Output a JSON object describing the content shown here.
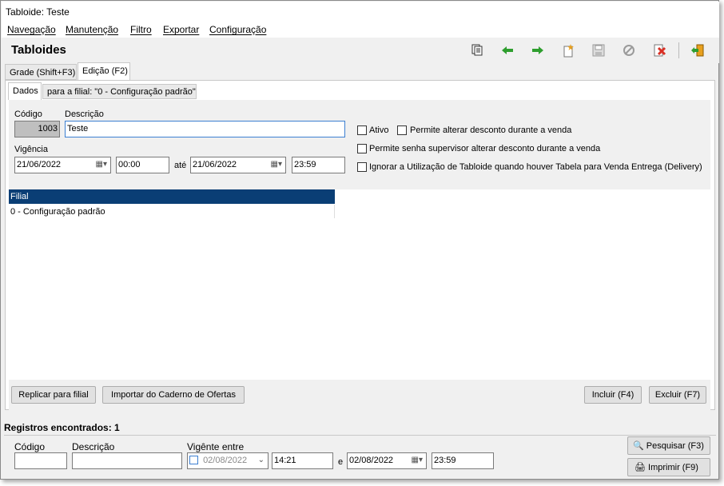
{
  "window": {
    "title": "Tabloide: Teste"
  },
  "menu": [
    "Navegação",
    "Manutenção",
    "Filtro",
    "Exportar",
    "Configuração"
  ],
  "page_title": "Tabloides",
  "toolbar": {
    "icons": [
      "copy-records-icon",
      "arrow-left-icon",
      "arrow-right-icon",
      "new-record-icon",
      "save-icon",
      "cancel-icon",
      "delete-icon",
      "exit-icon"
    ],
    "colors": {
      "arrows": "#2e9e2e",
      "new": "#e8a01e",
      "delete": "#d93025",
      "disabled": "#9a9a9a"
    }
  },
  "main_tabs": [
    "Grade (Shift+F3)",
    "Edição (F2)"
  ],
  "sub_tabs": [
    "Dados",
    "para a filial: \"0 - Configuração padrão\""
  ],
  "form": {
    "codigo_label": "Código",
    "codigo_value": "1003",
    "descricao_label": "Descrição",
    "descricao_value": "Teste",
    "vigencia_label": "Vigência",
    "date_from": "21/06/2022",
    "time_from": "00:00",
    "ate_label": "até",
    "date_to": "21/06/2022",
    "time_to": "23:59",
    "checkboxes": {
      "ativo": "Ativo",
      "permite_desconto": "Permite alterar desconto durante a venda",
      "permite_senha": "Permite senha supervisor alterar desconto durante a venda",
      "ignorar": "Ignorar a Utilização de Tabloide quando houver Tabela para Venda Entrega (Delivery)"
    }
  },
  "grid": {
    "header": "Filial",
    "rows": [
      "0 - Configuração padrão"
    ]
  },
  "buttons": {
    "replicar": "Replicar para filial",
    "importar": "Importar do Caderno de Ofertas",
    "incluir": "Incluir (F4)",
    "excluir": "Excluir (F7)"
  },
  "status": "Registros encontrados: 1",
  "search": {
    "codigo_label": "Código",
    "descricao_label": "Descrição",
    "vigente_label": "Vigênte entre",
    "date_from": "02/08/2022",
    "time_from": "14:21",
    "e_label": "e",
    "date_to": "02/08/2022",
    "time_to": "23:59",
    "pesquisar": "Pesquisar (F3)",
    "imprimir": "Imprimir (F9)"
  }
}
